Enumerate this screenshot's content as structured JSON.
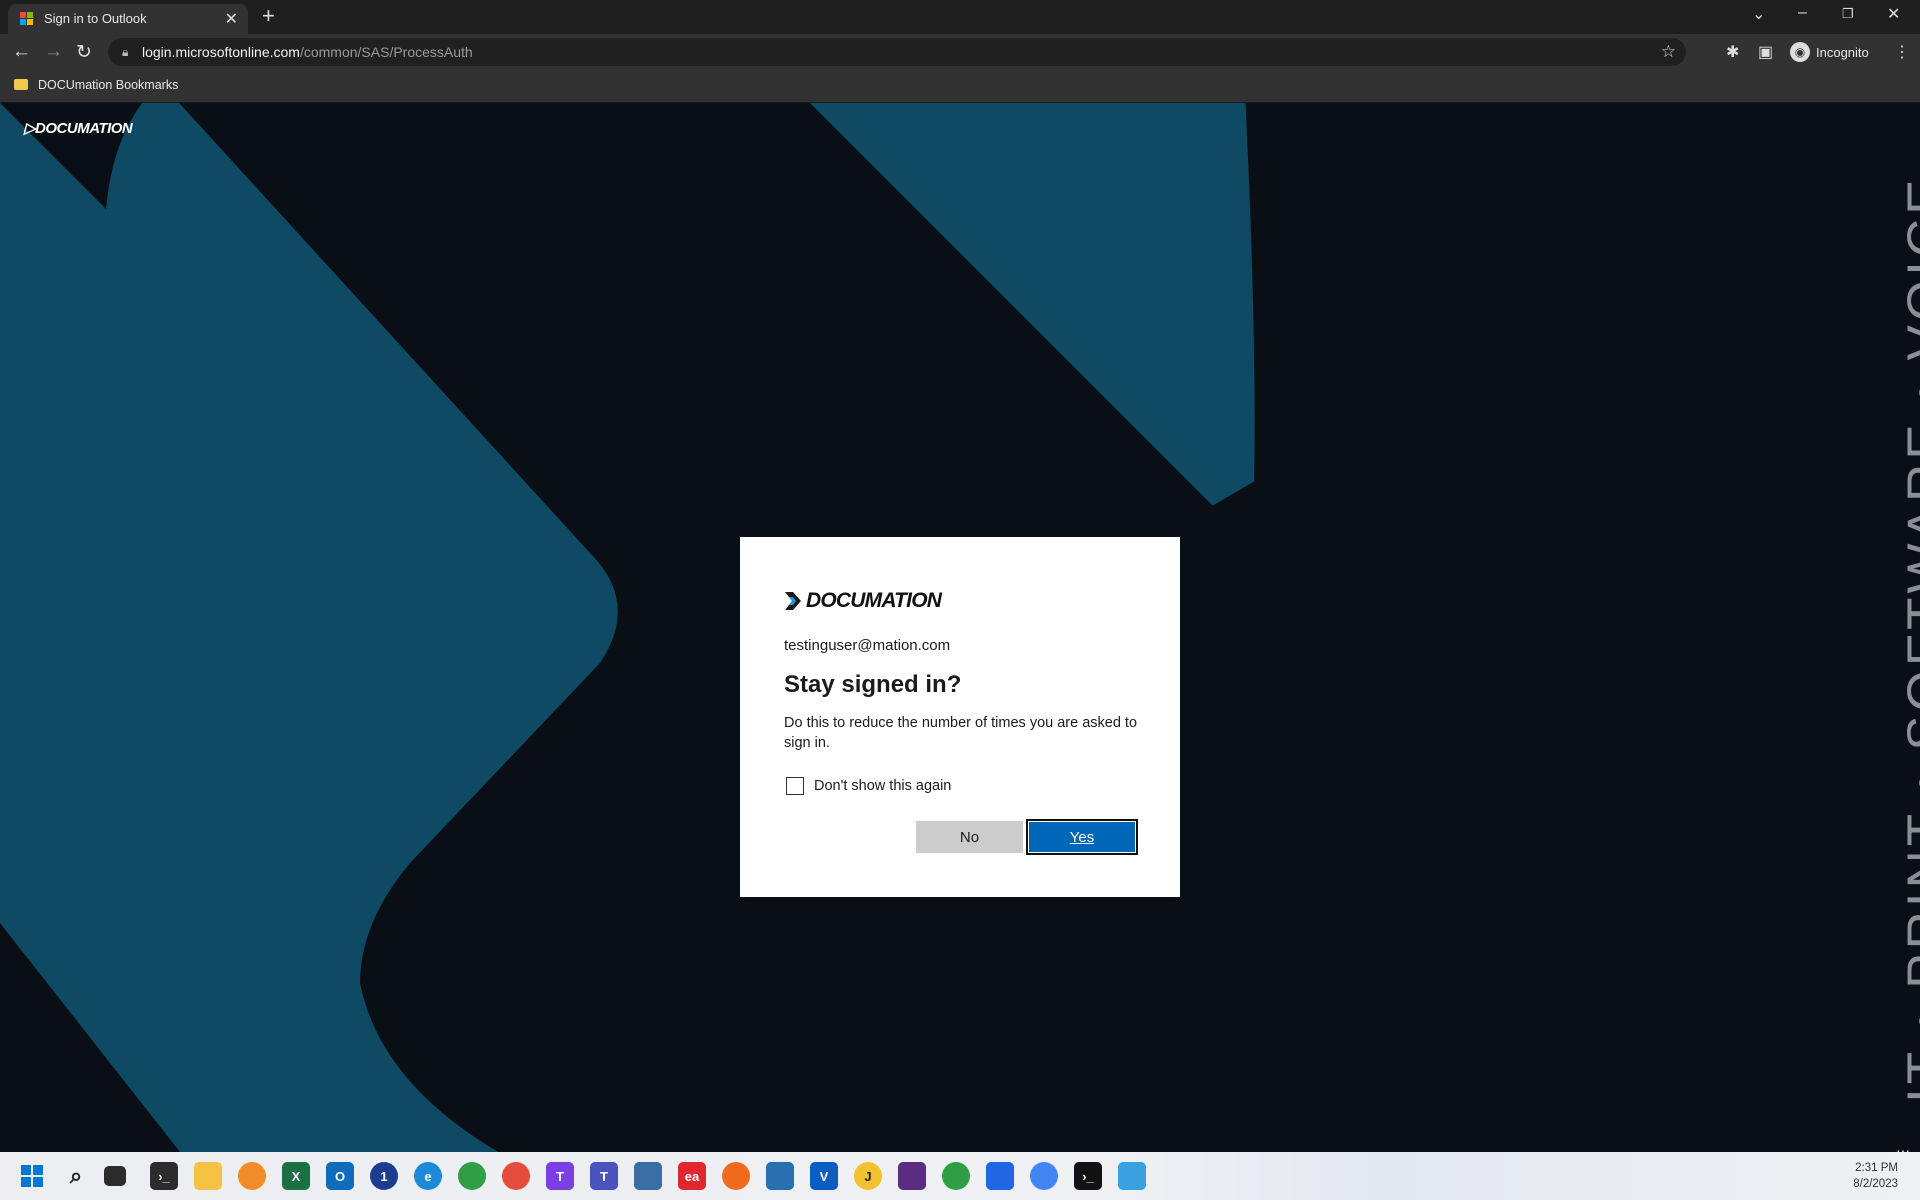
{
  "browser": {
    "tab_title": "Sign in to Outlook",
    "url_host": "login.microsoftonline.com",
    "url_path": "/common/SAS/ProcessAuth",
    "profile_label": "Incognito",
    "bookmark_folder": "DOCUmation Bookmarks"
  },
  "page": {
    "corner_logo": "DOCUMATION",
    "vertical_tagline": "IT • PRINT • SOFTWARE • VOICE",
    "colors": {
      "background": "#0a0f16",
      "shape": "#0f4a64",
      "tagline": "#8b8f94"
    }
  },
  "dialog": {
    "logo_text": "DOCUMATION",
    "email": "testinguser@mation.com",
    "title": "Stay signed in?",
    "description": "Do this to reduce the number of times you are asked to sign in.",
    "checkbox_label": "Don't show this again",
    "checkbox_checked": false,
    "no_label": "No",
    "yes_label": "Yes",
    "colors": {
      "primary": "#0067b8",
      "secondary": "#cccccc"
    }
  },
  "taskbar": {
    "apps": [
      "start",
      "search",
      "task-view",
      "terminal",
      "file-explorer",
      "chrome-canary",
      "excel",
      "outlook",
      "1password",
      "edge",
      "chrome",
      "chrome-profile",
      "teams-chat",
      "teams",
      "remote-desktop",
      "ea",
      "app-orange",
      "defender",
      "visio",
      "jira",
      "pdf",
      "chrome-person",
      "power-automate",
      "chrome-active",
      "command-prompt",
      "app-window"
    ],
    "time": "2:31 PM",
    "date": "8/2/2023"
  }
}
